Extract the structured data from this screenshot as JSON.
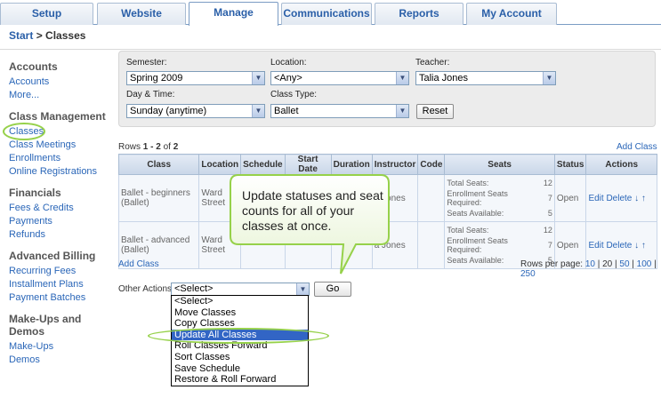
{
  "tabs": [
    "Setup",
    "Website",
    "Manage",
    "Communications",
    "Reports",
    "My Account"
  ],
  "breadcrumb": {
    "start": "Start",
    "sep": ">",
    "current": "Classes"
  },
  "sidebar": {
    "sections": [
      {
        "title": "Accounts",
        "links": [
          "Accounts",
          "More..."
        ]
      },
      {
        "title": "Class Management",
        "links": [
          "Classes",
          "Class Meetings",
          "Enrollments",
          "Online Registrations"
        ]
      },
      {
        "title": "Financials",
        "links": [
          "Fees & Credits",
          "Payments",
          "Refunds"
        ]
      },
      {
        "title": "Advanced Billing",
        "links": [
          "Recurring Fees",
          "Installment Plans",
          "Payment Batches"
        ]
      },
      {
        "title": "Make-Ups and Demos",
        "links": [
          "Make-Ups",
          "Demos"
        ]
      }
    ]
  },
  "filters": {
    "semester_label": "Semester:",
    "semester_value": "Spring 2009",
    "location_label": "Location:",
    "location_value": "<Any>",
    "teacher_label": "Teacher:",
    "teacher_value": "Talia Jones",
    "daytime_label": "Day & Time:",
    "daytime_value": "Sunday (anytime)",
    "classtype_label": "Class Type:",
    "classtype_value": "Ballet",
    "reset_label": "Reset"
  },
  "rows_info": {
    "prefix": "Rows",
    "range": "1 - 2",
    "of": "of",
    "total": "2"
  },
  "add_class_label": "Add Class",
  "table": {
    "headers": [
      "Class",
      "Location",
      "Schedule",
      "Start Date",
      "Duration",
      "Instructor",
      "Code",
      "Seats",
      "Status",
      "Actions"
    ],
    "rows": [
      {
        "class": "Ballet - beginners (Ballet)",
        "location": "Ward Street",
        "instructor": "a Jones",
        "seats": [
          [
            "Total Seats:",
            "12"
          ],
          [
            "Enrollment Seats Required:",
            "7"
          ],
          [
            "Seats Available:",
            "5"
          ]
        ],
        "status": "Open",
        "edit": "Edit",
        "delete": "Delete"
      },
      {
        "class": "Ballet - advanced (Ballet)",
        "location": "Ward Street",
        "instructor": "a Jones",
        "seats": [
          [
            "Total Seats:",
            "12"
          ],
          [
            "Enrollment Seats Required:",
            "7"
          ],
          [
            "Seats Available:",
            "5"
          ]
        ],
        "status": "Open",
        "edit": "Edit",
        "delete": "Delete"
      }
    ]
  },
  "rows_per_page": {
    "label": "Rows per page:",
    "options": [
      "10",
      "20",
      "50",
      "100",
      "250"
    ],
    "selected": "20"
  },
  "other_actions": {
    "label": "Other Actions:",
    "value": "<Select>",
    "go_label": "Go",
    "options": [
      "<Select>",
      "Move Classes",
      "Copy Classes",
      "Update All Classes",
      "Roll Classes Forward",
      "Sort Classes",
      "Save Schedule",
      "Restore & Roll Forward"
    ],
    "highlighted": "Update All Classes"
  },
  "callout": {
    "text": "Update statuses and seat counts for all of your classes at once."
  },
  "colors": {
    "accent": "#2a5fa8",
    "highlight": "#3265c5",
    "oval": "#96d14a"
  }
}
